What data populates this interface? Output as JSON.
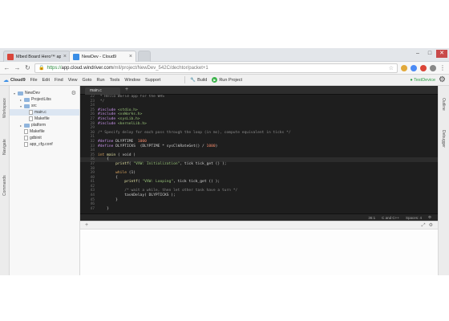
{
  "browser": {
    "tabs": [
      {
        "title": "Mbed Board Hero™ app"
      },
      {
        "title": "NewDev - Cloud9"
      }
    ],
    "url": {
      "protocol": "https://",
      "host": "app.cloud.windriver.com",
      "path": "/mll/project/NewDev_542C/dechtor/packet+1"
    },
    "win_buttons": [
      "–",
      "□",
      "✕"
    ],
    "nav": {
      "back": "←",
      "forward": "→",
      "reload": "↻",
      "star": "☆",
      "menu": "⋮"
    }
  },
  "menubar": {
    "logo": "Cloud9",
    "items": [
      "File",
      "Edit",
      "Find",
      "View",
      "Goto",
      "Run",
      "Tools",
      "Window",
      "Support"
    ],
    "build_label": "Build",
    "run_label": "Run Project",
    "test_device": "TestDevice"
  },
  "left_tabs": [
    "Workspace",
    "Navigate",
    "Commands"
  ],
  "right_tabs": [
    "Outline",
    "Debugger"
  ],
  "tree": {
    "items": [
      {
        "label": "NewDev",
        "type": "folder",
        "depth": 0,
        "arrow": "▾"
      },
      {
        "label": "ProjectLibs",
        "type": "folder",
        "depth": 1,
        "arrow": "▸"
      },
      {
        "label": "src",
        "type": "folder",
        "depth": 1,
        "arrow": "▾"
      },
      {
        "label": "main.c",
        "type": "file",
        "depth": 2,
        "arrow": "",
        "selected": true
      },
      {
        "label": "Makefile",
        "type": "file",
        "depth": 2,
        "arrow": ""
      },
      {
        "label": "platform",
        "type": "folder",
        "depth": 1,
        "arrow": "▸"
      },
      {
        "label": "Makefile",
        "type": "file",
        "depth": 1,
        "arrow": ""
      },
      {
        "label": "gdbinit",
        "type": "file",
        "depth": 1,
        "arrow": ""
      },
      {
        "label": "app_cfg.conf",
        "type": "file",
        "depth": 1,
        "arrow": ""
      }
    ]
  },
  "editor": {
    "tab_label": "main.c",
    "lines": [
      {
        "n": "22",
        "parts": [
          {
            "t": " * Hello World app for the WRS",
            "c": "t-comment"
          }
        ]
      },
      {
        "n": "23",
        "parts": [
          {
            "t": " */",
            "c": "t-comment"
          }
        ]
      },
      {
        "n": "24",
        "parts": []
      },
      {
        "n": "25",
        "parts": [
          {
            "t": "#include ",
            "c": "t-pre"
          },
          {
            "t": "<stdio.h>",
            "c": "t-str"
          }
        ]
      },
      {
        "n": "26",
        "parts": [
          {
            "t": "#include ",
            "c": "t-pre"
          },
          {
            "t": "<vxWorks.h>",
            "c": "t-str"
          }
        ]
      },
      {
        "n": "27",
        "parts": [
          {
            "t": "#include ",
            "c": "t-pre"
          },
          {
            "t": "<sysLib.h>",
            "c": "t-str"
          }
        ]
      },
      {
        "n": "28",
        "parts": [
          {
            "t": "#include ",
            "c": "t-pre"
          },
          {
            "t": "<kernelLib.h>",
            "c": "t-str"
          }
        ]
      },
      {
        "n": "29",
        "parts": []
      },
      {
        "n": "30",
        "parts": [
          {
            "t": "/* Specify delay for each pass through the loop (in ms), compute equivalent in ticks */",
            "c": "t-comment"
          }
        ]
      },
      {
        "n": "31",
        "parts": []
      },
      {
        "n": "32",
        "parts": [
          {
            "t": "#define ",
            "c": "t-pre"
          },
          {
            "t": "DLYPTIME  ",
            "c": "txt"
          },
          {
            "t": "1000",
            "c": "t-num"
          }
        ]
      },
      {
        "n": "33",
        "parts": [
          {
            "t": "#define ",
            "c": "t-pre"
          },
          {
            "t": "DLYPTICKS  (DLYPTIME * sysClkRateGet() / ",
            "c": "txt"
          },
          {
            "t": "1000",
            "c": "t-num"
          },
          {
            "t": ")",
            "c": "txt"
          }
        ]
      },
      {
        "n": "34",
        "parts": []
      },
      {
        "n": "35",
        "parts": [
          {
            "t": "int ",
            "c": "t-keyword"
          },
          {
            "t": "main ",
            "c": "t-fn"
          },
          {
            "t": "( void )",
            "c": "txt"
          }
        ]
      },
      {
        "n": "36",
        "parts": [
          {
            "t": "    {",
            "c": "txt"
          }
        ]
      },
      {
        "n": "37",
        "parts": [
          {
            "t": "        ",
            "c": "txt"
          },
          {
            "t": "printf",
            "c": "t-fn"
          },
          {
            "t": "( ",
            "c": "txt"
          },
          {
            "t": "\"VXW: Initialization\"",
            "c": "t-str"
          },
          {
            "t": ", tick tick_get () );",
            "c": "txt"
          }
        ]
      },
      {
        "n": "38",
        "parts": []
      },
      {
        "n": "39",
        "parts": [
          {
            "t": "        ",
            "c": "txt"
          },
          {
            "t": "while",
            "c": "t-keyword"
          },
          {
            "t": " (1)",
            "c": "txt"
          }
        ]
      },
      {
        "n": "40",
        "parts": [
          {
            "t": "        {",
            "c": "txt"
          }
        ]
      },
      {
        "n": "41",
        "parts": [
          {
            "t": "            ",
            "c": "txt"
          },
          {
            "t": "printf",
            "c": "t-fn"
          },
          {
            "t": "( ",
            "c": "txt"
          },
          {
            "t": "\"VXW: Looping\"",
            "c": "t-str"
          },
          {
            "t": ", tick tick_get () );",
            "c": "txt"
          }
        ]
      },
      {
        "n": "42",
        "parts": []
      },
      {
        "n": "43",
        "parts": [
          {
            "t": "            /* wait a while, then let other task have a turn */",
            "c": "t-comment"
          }
        ]
      },
      {
        "n": "44",
        "parts": [
          {
            "t": "            taskDelay( DLYPTICKS );",
            "c": "txt"
          }
        ]
      },
      {
        "n": "45",
        "parts": [
          {
            "t": "        }",
            "c": "txt"
          }
        ]
      },
      {
        "n": "46",
        "parts": []
      },
      {
        "n": "47",
        "parts": [
          {
            "t": "    }",
            "c": "txt"
          }
        ]
      }
    ],
    "status": {
      "position": "36:1",
      "language": "C and C++",
      "spaces": "Spaces: 4"
    }
  },
  "console": {
    "plus": "+",
    "icons": [
      "⤢",
      "⚙"
    ]
  }
}
